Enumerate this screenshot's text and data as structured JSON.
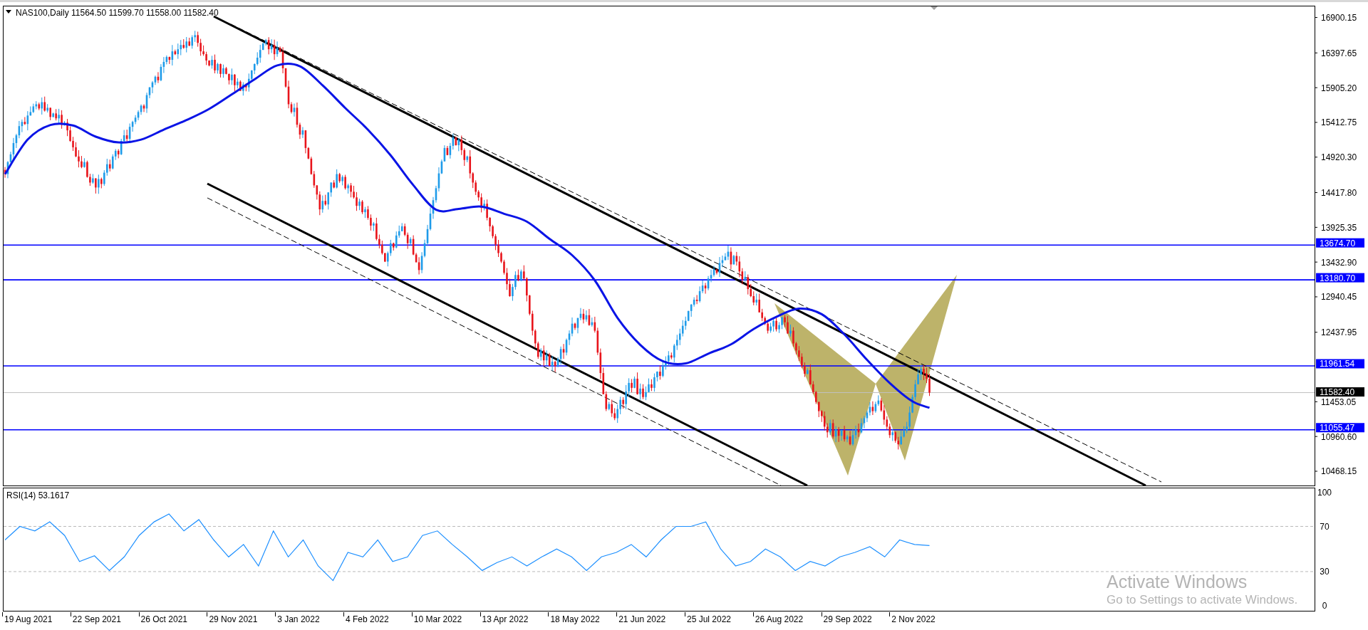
{
  "price_chart": {
    "title": "NAS100,Daily  11564.50 11599.70 11558.00 11582.40",
    "price_axis": [
      "16900.15",
      "16397.65",
      "15905.20",
      "15412.75",
      "14920.30",
      "14417.80",
      "13925.35",
      "13432.90",
      "12940.45",
      "12437.95",
      "11453.05",
      "10960.60",
      "10468.15"
    ],
    "levels": [
      "13674.70",
      "13180.70",
      "11961.54",
      "11055.47"
    ],
    "current_price": "11582.40"
  },
  "rsi_chart": {
    "chart_data": {
      "type": "line",
      "title": "RSI(14) 53.1617",
      "ylim": [
        -5,
        104
      ],
      "grid": true,
      "categories": [
        null,
        null,
        null,
        null,
        null,
        null,
        null,
        null,
        null,
        null,
        null,
        null,
        null,
        null,
        null,
        null,
        null,
        null,
        null,
        null,
        null,
        null,
        null,
        null,
        null,
        null,
        null,
        null,
        null,
        null,
        null,
        null,
        null,
        null,
        null,
        null,
        null,
        null,
        null,
        null,
        null,
        null,
        null,
        null,
        null,
        null,
        null,
        null,
        null,
        null,
        null,
        null,
        null,
        null,
        null,
        null,
        null,
        null,
        null,
        null,
        null,
        null,
        null
      ],
      "series": [
        {
          "color": "#1e90ff",
          "values": [
            58,
            70,
            66,
            74,
            62,
            39,
            44,
            31,
            43,
            62,
            74,
            81,
            66,
            76,
            58,
            43,
            54,
            35,
            66,
            43,
            58,
            35,
            22,
            47,
            43,
            58,
            39,
            43,
            62,
            66,
            54,
            43,
            31,
            38,
            43,
            35,
            43,
            50,
            43,
            31,
            43,
            47,
            54,
            43,
            58,
            70,
            70,
            74,
            50,
            35,
            39,
            50,
            43,
            31,
            39,
            35,
            43,
            47,
            52,
            43,
            58,
            54,
            53
          ]
        }
      ],
      "yticks": [
        {
          "value": 100,
          "label": "100"
        },
        {
          "value": 70,
          "label": "70"
        },
        {
          "value": 30,
          "label": "30"
        },
        {
          "value": 0,
          "label": "0"
        }
      ]
    }
  },
  "time_axis": [
    "19 Aug 2021",
    "22 Sep 2021",
    "26 Oct 2021",
    "29 Nov 2021",
    "3 Jan 2022",
    "4 Feb 2022",
    "10 Mar 2022",
    "13 Apr 2022",
    "18 May 2022",
    "21 Jun 2022",
    "25 Jul 2022",
    "26 Aug 2022",
    "29 Sep 2022",
    "2 Nov 2022"
  ],
  "notice": {
    "title": "Activate Windows",
    "text": "Go to Settings to activate Windows."
  }
}
